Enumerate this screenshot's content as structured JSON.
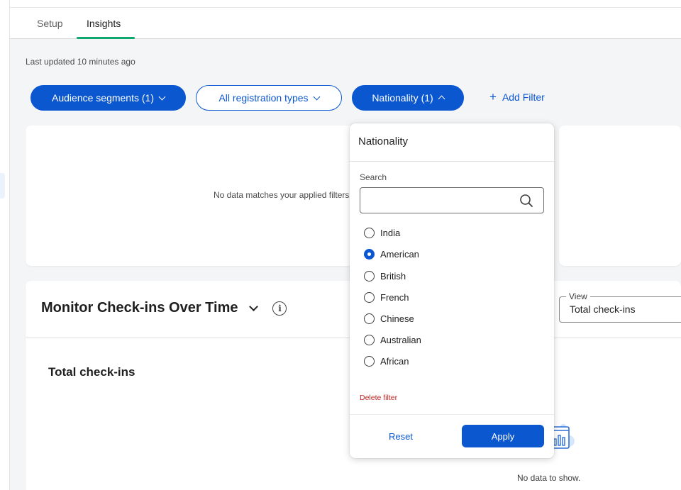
{
  "tabs": [
    {
      "label": "Setup",
      "active": false
    },
    {
      "label": "Insights",
      "active": true
    }
  ],
  "last_updated": "Last updated 10 minutes ago",
  "filters": {
    "audience_segments": "Audience segments (1)",
    "registration_types": "All registration types",
    "nationality": "Nationality (1)",
    "add_filter": "Add Filter"
  },
  "cards": {
    "no_data_applied": "No data matches your applied filters"
  },
  "monitor": {
    "title": "Monitor Check-ins Over Time",
    "view_label": "View",
    "view_value": "Total check-ins",
    "section_title": "Total check-ins",
    "no_data": "No data to show."
  },
  "popover": {
    "title": "Nationality",
    "search_label": "Search",
    "search_value": "",
    "options": [
      {
        "label": "India",
        "selected": false
      },
      {
        "label": "American",
        "selected": true
      },
      {
        "label": "British",
        "selected": false
      },
      {
        "label": "French",
        "selected": false
      },
      {
        "label": "Chinese",
        "selected": false
      },
      {
        "label": "Australian",
        "selected": false
      },
      {
        "label": "African",
        "selected": false
      }
    ],
    "delete_filter": "Delete filter",
    "reset": "Reset",
    "apply": "Apply"
  },
  "colors": {
    "primary": "#0b57d0",
    "tab_accent": "#0fa86e",
    "danger": "#c5221f",
    "page_bg": "#f4f5f7"
  }
}
